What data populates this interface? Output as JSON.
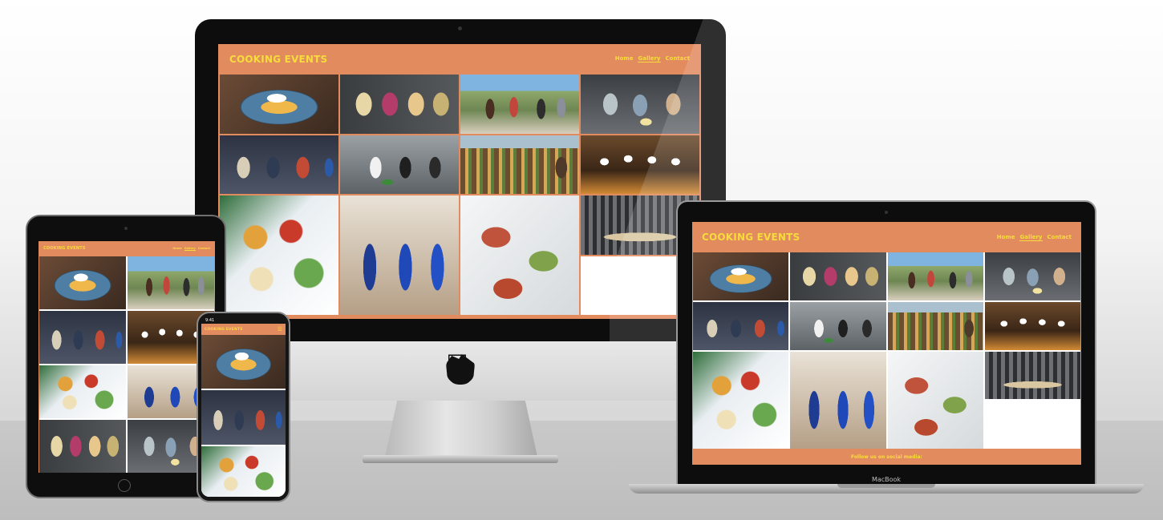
{
  "site": {
    "brand": "COOKING EVENTS",
    "nav": [
      {
        "label": "Home",
        "active": false
      },
      {
        "label": "Gallery",
        "active": true
      },
      {
        "label": "Contact",
        "active": false
      }
    ],
    "footer": "Follow us on social media:"
  },
  "devices": {
    "imac": {
      "logo_icon": "apple-logo-icon"
    },
    "macbook": {
      "label": "MacBook"
    },
    "ipad": {},
    "iphone": {
      "time": "9:41",
      "menu_icon": "hamburger-menu-icon"
    }
  },
  "colors": {
    "header_bg": "#e28b5f",
    "brand_text": "#f7dc3b"
  },
  "gallery": [
    "ceviche-dish",
    "tacos",
    "outdoor-group",
    "kids-cooking",
    "cooking-class",
    "kitchen-team",
    "long-table",
    "chefs-dinner",
    "event-hall",
    "bowls",
    "aprons-class",
    "platters"
  ]
}
